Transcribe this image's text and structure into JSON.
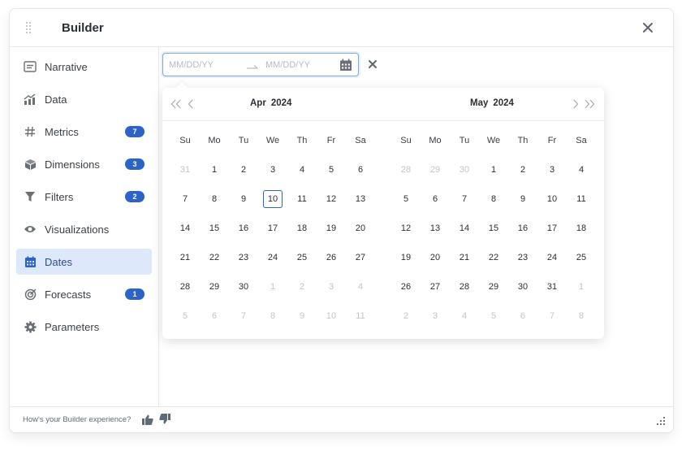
{
  "header": {
    "title": "Builder"
  },
  "sidebar": {
    "items": [
      {
        "label": "Narrative",
        "icon": "narrative-icon",
        "badge": null,
        "active": false
      },
      {
        "label": "Data",
        "icon": "data-icon",
        "badge": null,
        "active": false
      },
      {
        "label": "Metrics",
        "icon": "hash-icon",
        "badge": "7",
        "active": false
      },
      {
        "label": "Dimensions",
        "icon": "cube-icon",
        "badge": "3",
        "active": false
      },
      {
        "label": "Filters",
        "icon": "filter-icon",
        "badge": "2",
        "active": false
      },
      {
        "label": "Visualizations",
        "icon": "eye-icon",
        "badge": null,
        "active": false
      },
      {
        "label": "Dates",
        "icon": "calendar-icon",
        "badge": null,
        "active": true
      },
      {
        "label": "Forecasts",
        "icon": "target-icon",
        "badge": "1",
        "active": false
      },
      {
        "label": "Parameters",
        "icon": "gear-icon",
        "badge": null,
        "active": false
      }
    ]
  },
  "date_range": {
    "start_value": "",
    "start_placeholder": "MM/DD/YY",
    "end_value": "",
    "end_placeholder": "MM/DD/YY"
  },
  "picker": {
    "weekdays": [
      "Su",
      "Mo",
      "Tu",
      "We",
      "Th",
      "Fr",
      "Sa"
    ],
    "months": [
      {
        "month": "Apr",
        "year": "2024",
        "weeks": [
          [
            {
              "d": "31",
              "m": true
            },
            {
              "d": "1"
            },
            {
              "d": "2"
            },
            {
              "d": "3"
            },
            {
              "d": "4"
            },
            {
              "d": "5"
            },
            {
              "d": "6"
            }
          ],
          [
            {
              "d": "7"
            },
            {
              "d": "8"
            },
            {
              "d": "9"
            },
            {
              "d": "10",
              "today": true
            },
            {
              "d": "11"
            },
            {
              "d": "12"
            },
            {
              "d": "13"
            }
          ],
          [
            {
              "d": "14"
            },
            {
              "d": "15"
            },
            {
              "d": "16"
            },
            {
              "d": "17"
            },
            {
              "d": "18"
            },
            {
              "d": "19"
            },
            {
              "d": "20"
            }
          ],
          [
            {
              "d": "21"
            },
            {
              "d": "22"
            },
            {
              "d": "23"
            },
            {
              "d": "24"
            },
            {
              "d": "25"
            },
            {
              "d": "26"
            },
            {
              "d": "27"
            }
          ],
          [
            {
              "d": "28"
            },
            {
              "d": "29"
            },
            {
              "d": "30"
            },
            {
              "d": "1",
              "m": true
            },
            {
              "d": "2",
              "m": true
            },
            {
              "d": "3",
              "m": true
            },
            {
              "d": "4",
              "m": true
            }
          ],
          [
            {
              "d": "5",
              "m": true
            },
            {
              "d": "6",
              "m": true
            },
            {
              "d": "7",
              "m": true
            },
            {
              "d": "8",
              "m": true
            },
            {
              "d": "9",
              "m": true
            },
            {
              "d": "10",
              "m": true
            },
            {
              "d": "11",
              "m": true
            }
          ]
        ]
      },
      {
        "month": "May",
        "year": "2024",
        "weeks": [
          [
            {
              "d": "28",
              "m": true
            },
            {
              "d": "29",
              "m": true
            },
            {
              "d": "30",
              "m": true
            },
            {
              "d": "1"
            },
            {
              "d": "2"
            },
            {
              "d": "3"
            },
            {
              "d": "4"
            }
          ],
          [
            {
              "d": "5"
            },
            {
              "d": "6"
            },
            {
              "d": "7"
            },
            {
              "d": "8"
            },
            {
              "d": "9"
            },
            {
              "d": "10"
            },
            {
              "d": "11"
            }
          ],
          [
            {
              "d": "12"
            },
            {
              "d": "13"
            },
            {
              "d": "14"
            },
            {
              "d": "15"
            },
            {
              "d": "16"
            },
            {
              "d": "17"
            },
            {
              "d": "18"
            }
          ],
          [
            {
              "d": "19"
            },
            {
              "d": "20"
            },
            {
              "d": "21"
            },
            {
              "d": "22"
            },
            {
              "d": "23"
            },
            {
              "d": "24"
            },
            {
              "d": "25"
            }
          ],
          [
            {
              "d": "26"
            },
            {
              "d": "27"
            },
            {
              "d": "28"
            },
            {
              "d": "29"
            },
            {
              "d": "30"
            },
            {
              "d": "31"
            },
            {
              "d": "1",
              "m": true
            }
          ],
          [
            {
              "d": "2",
              "m": true
            },
            {
              "d": "3",
              "m": true
            },
            {
              "d": "4",
              "m": true
            },
            {
              "d": "5",
              "m": true
            },
            {
              "d": "6",
              "m": true
            },
            {
              "d": "7",
              "m": true
            },
            {
              "d": "8",
              "m": true
            }
          ]
        ]
      }
    ]
  },
  "footer": {
    "feedback_text": "How's your Builder experience?"
  },
  "colors": {
    "accent": "#2b63c9",
    "active_bg": "#dde8fb",
    "today_border": "#2e62c4"
  }
}
